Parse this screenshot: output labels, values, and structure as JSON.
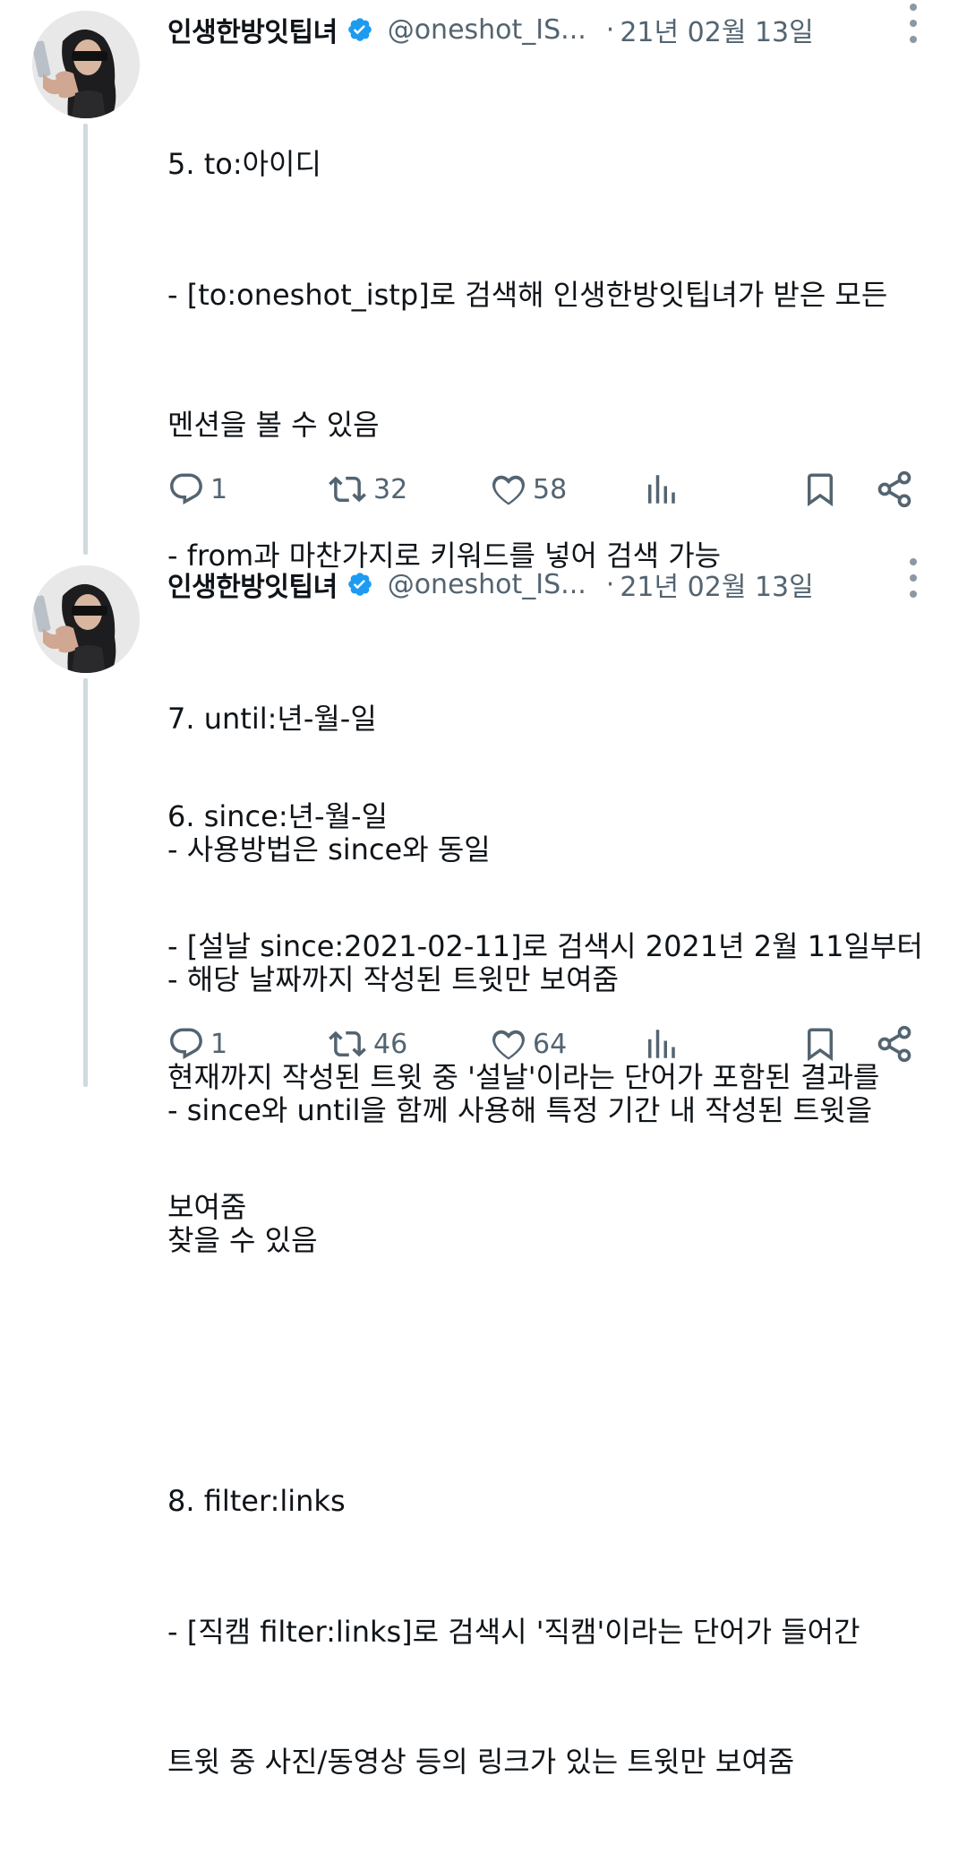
{
  "tweets": [
    {
      "author": {
        "name": "인생한방잇팁녀",
        "handle": "@oneshot_IS...",
        "verified": true
      },
      "separator": "·",
      "date": "21년 02월 13일",
      "body_lines": [
        "5. to:아이디",
        "- [to:oneshot_istp]로 검색해 인생한방잇팁녀가 받은 모든",
        "멘션을 볼 수 있음",
        "- from과 마찬가지로 키워드를 넣어 검색 가능",
        "",
        "6. since:년-월-일",
        "- [설날 since:2021-02-11]로 검색시 2021년 2월 11일부터",
        "현재까지 작성된 트윗 중 '설날'이라는 단어가 포함된 결과를",
        "보여줌"
      ],
      "stats": {
        "replies": "1",
        "retweets": "32",
        "likes": "58"
      }
    },
    {
      "author": {
        "name": "인생한방잇팁녀",
        "handle": "@oneshot_IS...",
        "verified": true
      },
      "separator": "·",
      "date": "21년 02월 13일",
      "body_lines": [
        "7. until:년-월-일",
        "- 사용방법은 since와 동일",
        "- 해당 날짜까지 작성된 트윗만 보여줌",
        "- since와 until을 함께 사용해 특정 기간 내 작성된 트윗을",
        "찾을 수 있음",
        "",
        "8. filter:links",
        "- [직캠 filter:links]로 검색시 '직캠'이라는 단어가 들어간",
        "트윗 중 사진/동영상 등의 링크가 있는 트윗만 보여줌"
      ],
      "stats": {
        "replies": "1",
        "retweets": "46",
        "likes": "64"
      }
    }
  ],
  "icons": {
    "verified": "verified-badge-icon",
    "more": "more-vertical-icon",
    "reply": "reply-icon",
    "retweet": "retweet-icon",
    "like": "heart-icon",
    "views": "views-chart-icon",
    "bookmark": "bookmark-icon",
    "share": "share-icon"
  },
  "colors": {
    "text": "#0f1419",
    "secondary": "#536471",
    "verified": "#1d9bf0",
    "thread_line": "#cfd9de"
  }
}
